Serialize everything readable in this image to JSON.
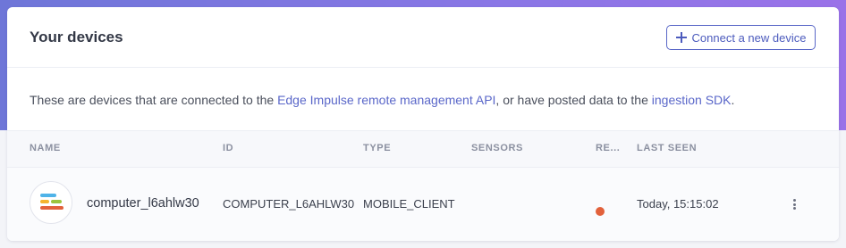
{
  "header": {
    "title": "Your devices",
    "connect_button_label": "Connect a new device"
  },
  "description": {
    "prefix": "These are devices that are connected to the ",
    "link1": "Edge Impulse remote management API",
    "middle": ", or have posted data to the ",
    "link2": "ingestion SDK",
    "suffix": "."
  },
  "table": {
    "columns": {
      "name": "NAME",
      "id": "ID",
      "type": "TYPE",
      "sensors": "SENSORS",
      "remote": "RE...",
      "last_seen": "LAST SEEN"
    },
    "rows": [
      {
        "name": "computer_l6ahlw30",
        "id": "COMPUTER_L6AHLW30",
        "type": "MOBILE_CLIENT",
        "sensors": "",
        "remote_status_color": "#e2613b",
        "last_seen": "Today, 15:15:02"
      }
    ]
  },
  "colors": {
    "accent": "#5a67c9",
    "background_gradient_start": "#6e76d8",
    "background_gradient_end": "#9a72e8",
    "status_offline": "#e2613b"
  },
  "icons": {
    "device_avatar": "device-avatar-icon",
    "add": "plus-icon",
    "row_actions": "kebab-menu-icon"
  }
}
